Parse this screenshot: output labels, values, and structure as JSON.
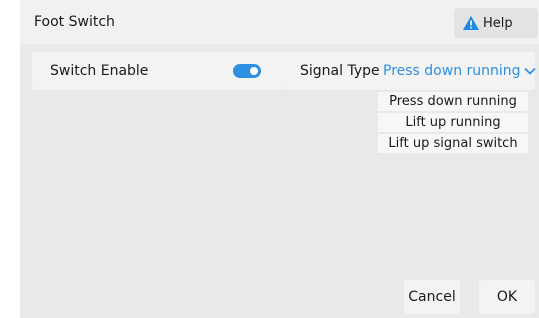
{
  "dialog": {
    "title": "Foot Switch",
    "help_label": "Help"
  },
  "switch_enable": {
    "label": "Switch Enable",
    "enabled": true
  },
  "signal_type": {
    "label": "Signal Type",
    "selected": "Press down running",
    "options": [
      "Press down running",
      "Lift up running",
      "Lift up signal switch"
    ]
  },
  "footer": {
    "cancel_label": "Cancel",
    "ok_label": "OK"
  },
  "colors": {
    "accent": "#2f8fe0",
    "warning": "#1e88e5"
  },
  "icons": {
    "help": "warning-triangle-icon",
    "dropdown": "chevron-down-icon"
  }
}
